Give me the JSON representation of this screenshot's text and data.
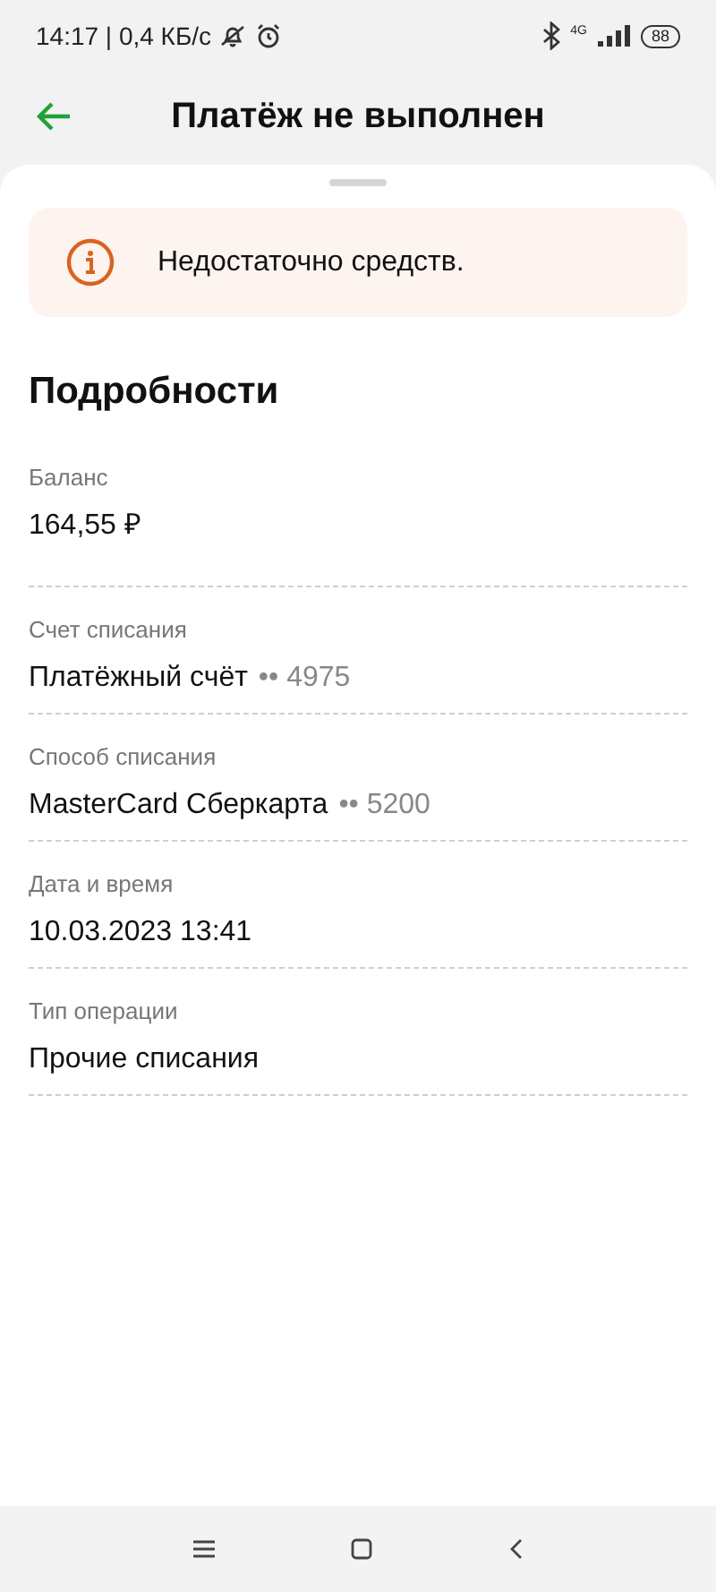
{
  "status_bar": {
    "time": "14:17 | 0,4 КБ/с",
    "network": "4G",
    "battery": "88"
  },
  "header": {
    "title": "Платёж не выполнен"
  },
  "alert": {
    "text": "Недостаточно средств."
  },
  "details": {
    "title": "Подробности",
    "rows": [
      {
        "label": "Баланс",
        "value": "164,55 ₽"
      },
      {
        "label": "Счет списания",
        "value": "Платёжный счёт",
        "suffix": "•• 4975"
      },
      {
        "label": "Способ списания",
        "value": "MasterCard Сберкарта",
        "suffix": "•• 5200"
      },
      {
        "label": "Дата и время",
        "value": "10.03.2023 13:41"
      },
      {
        "label": "Тип операции",
        "value": "Прочие списания"
      }
    ]
  }
}
